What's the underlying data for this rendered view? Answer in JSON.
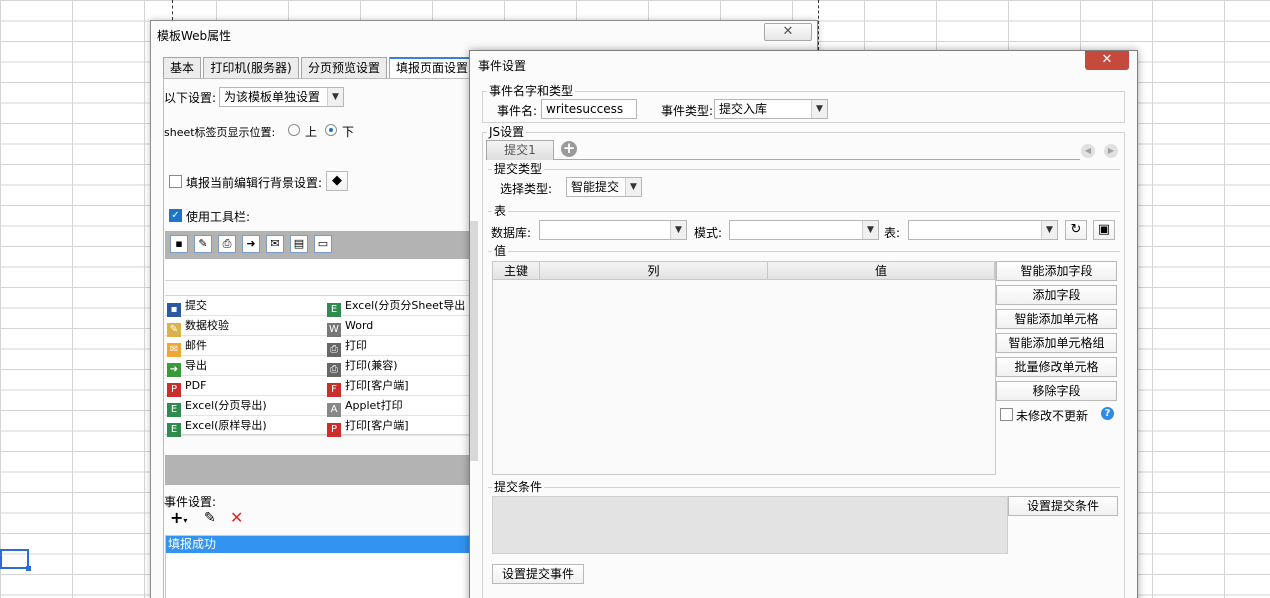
{
  "left_dialog": {
    "title": "模板Web属性",
    "close_glyph": "✕",
    "tabs": [
      "基本",
      "打印机(服务器)",
      "分页预览设置",
      "填报页面设置"
    ],
    "settings_label": "以下设置:",
    "settings_value": "为该模板单独设置",
    "sheet_pos_label": "sheet标签页显示位置:",
    "sheet_pos_top": "上",
    "sheet_pos_bottom": "下",
    "fill_bg_label": "填报当前编辑行背景设置:",
    "use_toolbar_label": "使用工具栏:",
    "toolbar_buttons": {
      "left": [
        "提交",
        "数据校验",
        "邮件",
        "导出",
        "PDF",
        "Excel(分页导出)",
        "Excel(原样导出)"
      ],
      "right": [
        "Excel(分页分Sheet导出",
        "Word",
        "打印",
        "打印(兼容)",
        "打印[客户端]",
        "Applet打印",
        "打印[客户端]"
      ]
    },
    "event_settings_label": "事件设置:",
    "event_list": [
      "填报成功"
    ]
  },
  "right_dialog": {
    "title": "事件设置",
    "close_glyph": "✕",
    "name_group_title": "事件名字和类型",
    "event_name_label": "事件名:",
    "event_name_value": "writesuccess",
    "event_type_label": "事件类型:",
    "event_type_value": "提交入库",
    "js_group_title": "JS设置",
    "submit_tab": "提交1",
    "submit_type_title": "提交类型",
    "select_type_label": "选择类型:",
    "select_type_value": "智能提交",
    "table_section_title": "表",
    "db_label": "数据库:",
    "schema_label": "模式:",
    "table_label": "表:",
    "value_section_title": "值",
    "columns": [
      "主键",
      "列",
      "值"
    ],
    "side_buttons": [
      "智能添加字段",
      "添加字段",
      "智能添加单元格",
      "智能添加单元格组",
      "批量修改单元格",
      "移除字段"
    ],
    "no_update_label": "未修改不更新",
    "submit_cond_title": "提交条件",
    "set_cond_button": "设置提交条件",
    "set_event_button": "设置提交事件"
  }
}
